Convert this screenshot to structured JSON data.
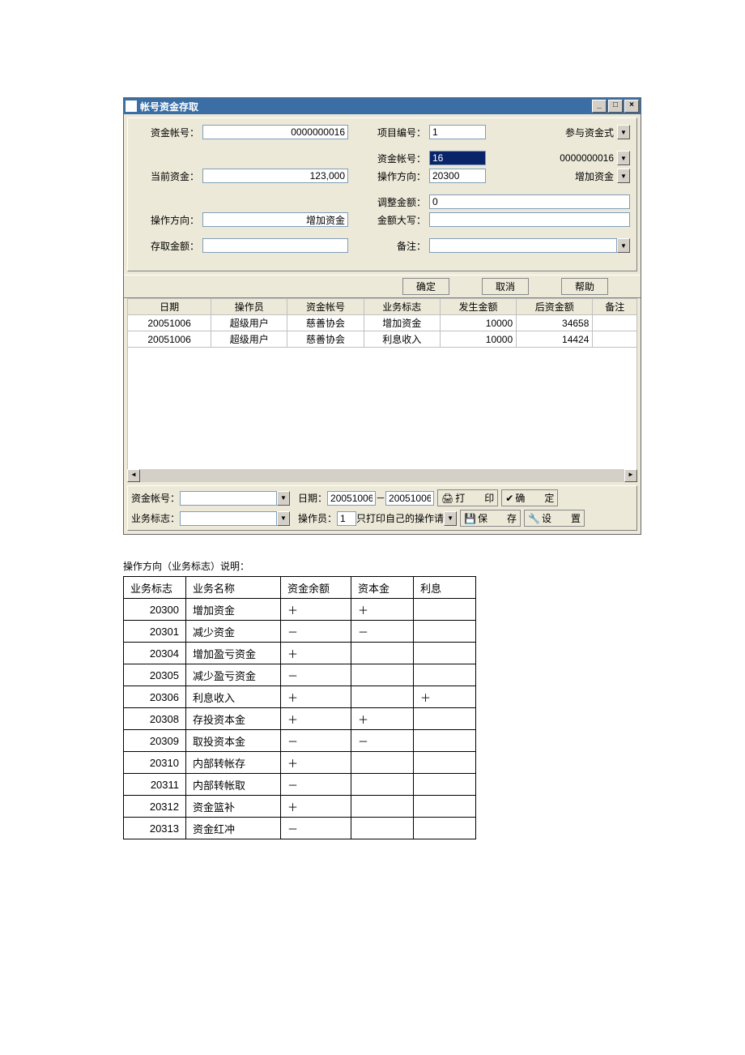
{
  "window": {
    "title": "帐号资金存取",
    "min": "_",
    "max": "□",
    "close": "×"
  },
  "form": {
    "acct_lbl": "资金帐号：",
    "acct_val": "0000000016",
    "proj_lbl": "项目编号：",
    "proj_val": "1",
    "proj_mode": "参与资金式",
    "acct2_lbl": "资金帐号：",
    "acct2_val": "16",
    "acct2_num": "0000000016",
    "cur_lbl": "当前资金：",
    "cur_val": "123,000",
    "dir2_lbl": "操作方向：",
    "dir2_code": "20300",
    "dir2_name": "增加资金",
    "adj_lbl": "调整金额：",
    "adj_val": "0",
    "dir_lbl": "操作方向：",
    "dir_val": "增加资金",
    "upper_lbl": "金额大写：",
    "upper_val": "",
    "amt_lbl": "存取金额：",
    "amt_val": "",
    "remark_lbl": "备注：",
    "remark_val": ""
  },
  "buttons": {
    "ok": "确定",
    "cancel": "取消",
    "help": "帮助"
  },
  "grid": {
    "headers": [
      "日期",
      "操作员",
      "资金帐号",
      "业务标志",
      "发生金额",
      "后资金额",
      "备注"
    ],
    "rows": [
      {
        "date": "20051006",
        "op": "超级用户",
        "acct": "慈善协会",
        "flag": "增加资金",
        "amt": "10000",
        "after": "34658",
        "rem": ""
      },
      {
        "date": "20051006",
        "op": "超级用户",
        "acct": "慈善协会",
        "flag": "利息收入",
        "amt": "10000",
        "after": "14424",
        "rem": ""
      }
    ]
  },
  "bottom": {
    "acct_lbl": "资金帐号：",
    "date_lbl": "日期：",
    "date_from": "20051006",
    "date_sep": "－",
    "date_to": "20051006",
    "flag_lbl": "业务标志：",
    "op_lbl": "操作员：",
    "op_val": "1",
    "op_note": "只打印自己的操作请",
    "print": "打　　印",
    "confirm": "确　　定",
    "save": "保　　存",
    "setup": "设　　置"
  },
  "explain": {
    "caption": "操作方向（业务标志）说明：",
    "headers": [
      "业务标志",
      "业务名称",
      "资金余额",
      "资本金",
      "利息"
    ],
    "rows": [
      {
        "code": "20300",
        "name": "增加资金",
        "bal": "＋",
        "cap": "＋",
        "int": ""
      },
      {
        "code": "20301",
        "name": "减少资金",
        "bal": "－",
        "cap": "－",
        "int": ""
      },
      {
        "code": "20304",
        "name": "增加盈亏资金",
        "bal": "＋",
        "cap": "",
        "int": ""
      },
      {
        "code": "20305",
        "name": "减少盈亏资金",
        "bal": "－",
        "cap": "",
        "int": ""
      },
      {
        "code": "20306",
        "name": "利息收入",
        "bal": "＋",
        "cap": "",
        "int": "＋"
      },
      {
        "code": "20308",
        "name": "存投资本金",
        "bal": "＋",
        "cap": "＋",
        "int": ""
      },
      {
        "code": "20309",
        "name": "取投资本金",
        "bal": "－",
        "cap": "－",
        "int": ""
      },
      {
        "code": "20310",
        "name": "内部转帐存",
        "bal": "＋",
        "cap": "",
        "int": ""
      },
      {
        "code": "20311",
        "name": "内部转帐取",
        "bal": "－",
        "cap": "",
        "int": ""
      },
      {
        "code": "20312",
        "name": "资金篮补",
        "bal": "＋",
        "cap": "",
        "int": ""
      },
      {
        "code": "20313",
        "name": "资金红冲",
        "bal": "－",
        "cap": "",
        "int": ""
      }
    ]
  },
  "chart_data": {
    "type": "table",
    "title": "操作方向（业务标志）说明",
    "columns": [
      "业务标志",
      "业务名称",
      "资金余额",
      "资本金",
      "利息"
    ],
    "rows": [
      [
        "20300",
        "增加资金",
        "+",
        "+",
        ""
      ],
      [
        "20301",
        "减少资金",
        "-",
        "-",
        ""
      ],
      [
        "20304",
        "增加盈亏资金",
        "+",
        "",
        ""
      ],
      [
        "20305",
        "减少盈亏资金",
        "-",
        "",
        ""
      ],
      [
        "20306",
        "利息收入",
        "+",
        "",
        "+"
      ],
      [
        "20308",
        "存投资本金",
        "+",
        "+",
        ""
      ],
      [
        "20309",
        "取投资本金",
        "-",
        "-",
        ""
      ],
      [
        "20310",
        "内部转帐存",
        "+",
        "",
        ""
      ],
      [
        "20311",
        "内部转帐取",
        "-",
        "",
        ""
      ],
      [
        "20312",
        "资金篮补",
        "+",
        "",
        ""
      ],
      [
        "20313",
        "资金红冲",
        "-",
        "",
        ""
      ]
    ]
  }
}
